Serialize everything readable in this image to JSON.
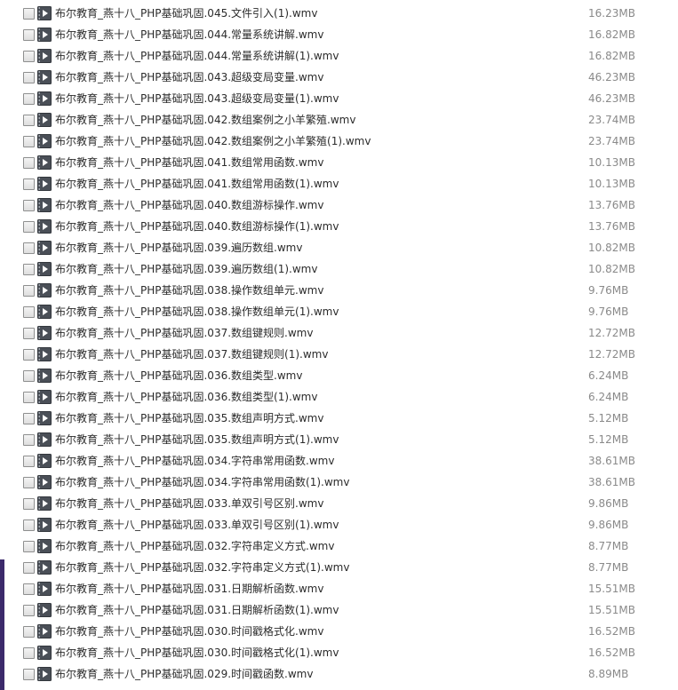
{
  "files": [
    {
      "name": "布尔教育_燕十八_PHP基础巩固.045.文件引入(1).wmv",
      "size": "16.23MB"
    },
    {
      "name": "布尔教育_燕十八_PHP基础巩固.044.常量系统讲解.wmv",
      "size": "16.82MB"
    },
    {
      "name": "布尔教育_燕十八_PHP基础巩固.044.常量系统讲解(1).wmv",
      "size": "16.82MB"
    },
    {
      "name": "布尔教育_燕十八_PHP基础巩固.043.超级变局变量.wmv",
      "size": "46.23MB"
    },
    {
      "name": "布尔教育_燕十八_PHP基础巩固.043.超级变局变量(1).wmv",
      "size": "46.23MB"
    },
    {
      "name": "布尔教育_燕十八_PHP基础巩固.042.数组案例之小羊繁殖.wmv",
      "size": "23.74MB"
    },
    {
      "name": "布尔教育_燕十八_PHP基础巩固.042.数组案例之小羊繁殖(1).wmv",
      "size": "23.74MB"
    },
    {
      "name": "布尔教育_燕十八_PHP基础巩固.041.数组常用函数.wmv",
      "size": "10.13MB"
    },
    {
      "name": "布尔教育_燕十八_PHP基础巩固.041.数组常用函数(1).wmv",
      "size": "10.13MB"
    },
    {
      "name": "布尔教育_燕十八_PHP基础巩固.040.数组游标操作.wmv",
      "size": "13.76MB"
    },
    {
      "name": "布尔教育_燕十八_PHP基础巩固.040.数组游标操作(1).wmv",
      "size": "13.76MB"
    },
    {
      "name": "布尔教育_燕十八_PHP基础巩固.039.遍历数组.wmv",
      "size": "10.82MB"
    },
    {
      "name": "布尔教育_燕十八_PHP基础巩固.039.遍历数组(1).wmv",
      "size": "10.82MB"
    },
    {
      "name": "布尔教育_燕十八_PHP基础巩固.038.操作数组单元.wmv",
      "size": "9.76MB"
    },
    {
      "name": "布尔教育_燕十八_PHP基础巩固.038.操作数组单元(1).wmv",
      "size": "9.76MB"
    },
    {
      "name": "布尔教育_燕十八_PHP基础巩固.037.数组键规则.wmv",
      "size": "12.72MB"
    },
    {
      "name": "布尔教育_燕十八_PHP基础巩固.037.数组键规则(1).wmv",
      "size": "12.72MB"
    },
    {
      "name": "布尔教育_燕十八_PHP基础巩固.036.数组类型.wmv",
      "size": "6.24MB"
    },
    {
      "name": "布尔教育_燕十八_PHP基础巩固.036.数组类型(1).wmv",
      "size": "6.24MB"
    },
    {
      "name": "布尔教育_燕十八_PHP基础巩固.035.数组声明方式.wmv",
      "size": "5.12MB"
    },
    {
      "name": "布尔教育_燕十八_PHP基础巩固.035.数组声明方式(1).wmv",
      "size": "5.12MB"
    },
    {
      "name": "布尔教育_燕十八_PHP基础巩固.034.字符串常用函数.wmv",
      "size": "38.61MB"
    },
    {
      "name": "布尔教育_燕十八_PHP基础巩固.034.字符串常用函数(1).wmv",
      "size": "38.61MB"
    },
    {
      "name": "布尔教育_燕十八_PHP基础巩固.033.单双引号区别.wmv",
      "size": "9.86MB"
    },
    {
      "name": "布尔教育_燕十八_PHP基础巩固.033.单双引号区别(1).wmv",
      "size": "9.86MB"
    },
    {
      "name": "布尔教育_燕十八_PHP基础巩固.032.字符串定义方式.wmv",
      "size": "8.77MB"
    },
    {
      "name": "布尔教育_燕十八_PHP基础巩固.032.字符串定义方式(1).wmv",
      "size": "8.77MB"
    },
    {
      "name": "布尔教育_燕十八_PHP基础巩固.031.日期解析函数.wmv",
      "size": "15.51MB"
    },
    {
      "name": "布尔教育_燕十八_PHP基础巩固.031.日期解析函数(1).wmv",
      "size": "15.51MB"
    },
    {
      "name": "布尔教育_燕十八_PHP基础巩固.030.时间戳格式化.wmv",
      "size": "16.52MB"
    },
    {
      "name": "布尔教育_燕十八_PHP基础巩固.030.时间戳格式化(1).wmv",
      "size": "16.52MB"
    },
    {
      "name": "布尔教育_燕十八_PHP基础巩固.029.时间戳函数.wmv",
      "size": "8.89MB"
    }
  ],
  "file_icon": "video-file-icon",
  "colors": {
    "name_text": "#2b2b2b",
    "size_text": "#8a8a8a",
    "icon_fill": "#4a4f57"
  }
}
